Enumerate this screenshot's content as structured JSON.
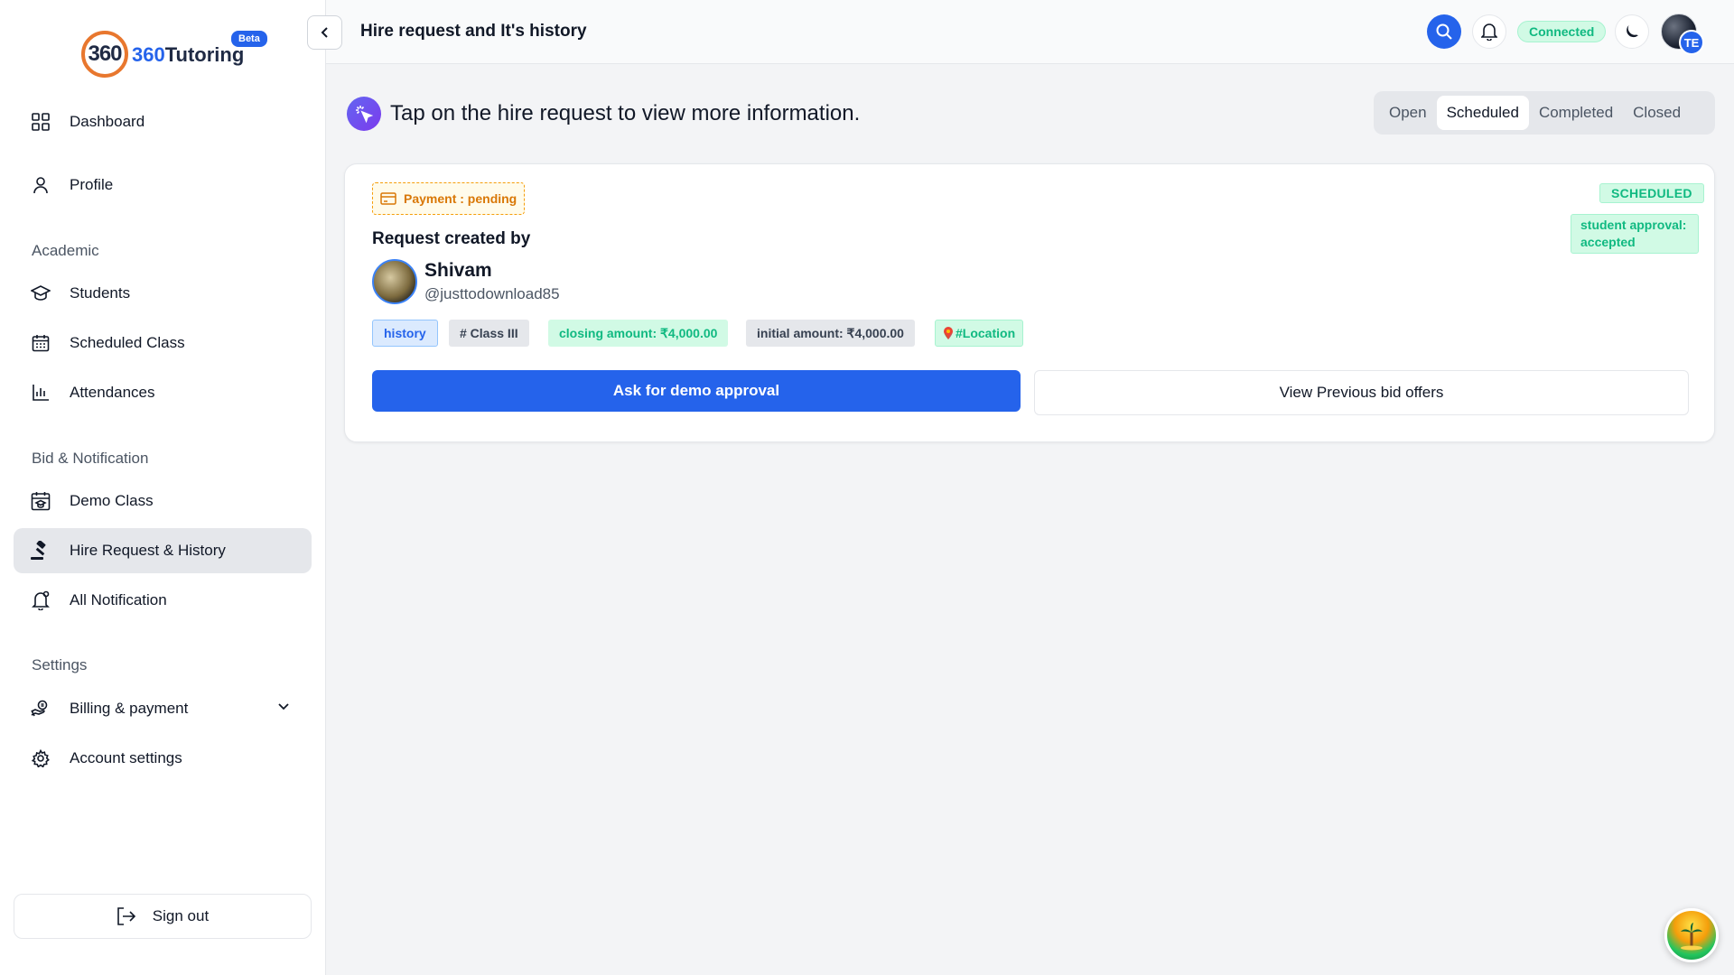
{
  "brand": {
    "badge_text": "360",
    "name_number": "360",
    "name_text": "Tutoring",
    "beta_label": "Beta"
  },
  "sidebar": {
    "items": [
      {
        "label": "Dashboard",
        "icon": "grid-icon"
      },
      {
        "label": "Profile",
        "icon": "user-icon"
      }
    ],
    "academic_label": "Academic",
    "academic_items": [
      {
        "label": "Students",
        "icon": "graduation-cap-icon"
      },
      {
        "label": "Scheduled Class",
        "icon": "calendar-icon"
      },
      {
        "label": "Attendances",
        "icon": "bar-chart-icon"
      }
    ],
    "bid_label": "Bid & Notification",
    "bid_items": [
      {
        "label": "Demo Class",
        "icon": "calendar-demo-icon"
      },
      {
        "label": "Hire Request & History",
        "icon": "gavel-icon",
        "active": true
      },
      {
        "label": "All Notification",
        "icon": "bell-icon"
      }
    ],
    "settings_label": "Settings",
    "settings_items": [
      {
        "label": "Billing & payment",
        "icon": "payment-icon"
      },
      {
        "label": "Account settings",
        "icon": "gear-icon"
      }
    ],
    "signout_label": "Sign out"
  },
  "header": {
    "title": "Hire request and It's history",
    "status": "Connected",
    "avatar_initials": "TE"
  },
  "main": {
    "info_text": "Tap on the hire request to view more information.",
    "tabs": [
      {
        "label": "Open",
        "active": false
      },
      {
        "label": "Scheduled",
        "active": true
      },
      {
        "label": "Completed",
        "active": false
      },
      {
        "label": "Closed",
        "active": false
      }
    ]
  },
  "card": {
    "payment_label": "Payment : pending",
    "request_title": "Request created by",
    "user_name": "Shivam",
    "user_handle": "@justtodownload85",
    "tags": {
      "history": "history",
      "class": "# Class III",
      "closing": "closing amount: ₹4,000.00",
      "initial": "initial amount: ₹4,000.00",
      "location": "#Location"
    },
    "status": "SCHEDULED",
    "approval": "student approval: accepted",
    "primary_button": "Ask for demo approval",
    "secondary_button": "View Previous bid offers"
  },
  "colors": {
    "accent": "#2563eb",
    "success": "#10b981",
    "warning": "#d97706"
  }
}
